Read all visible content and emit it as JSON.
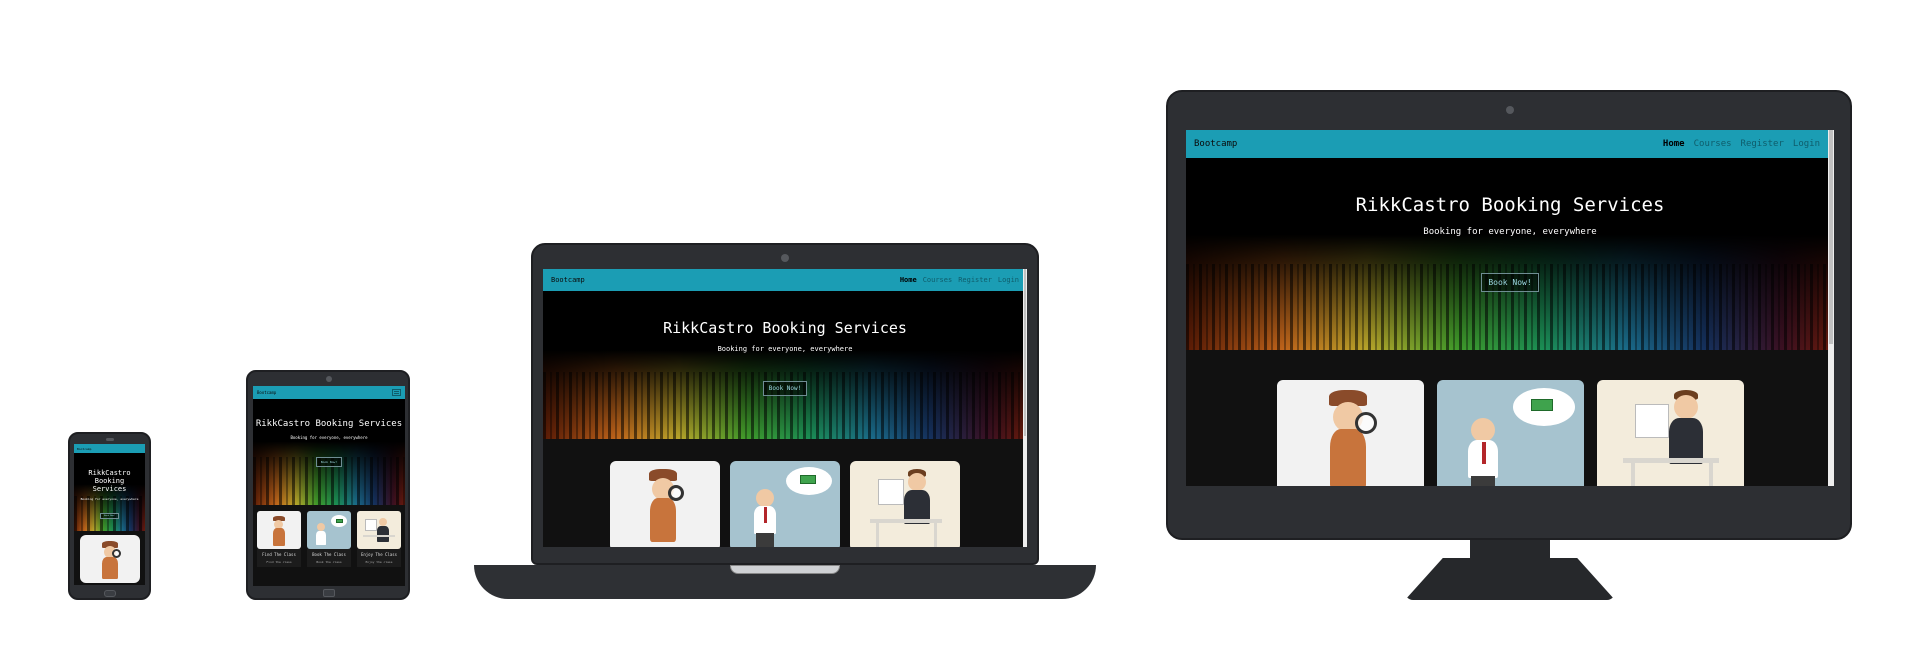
{
  "site": {
    "brand": "Bootcamp",
    "nav": [
      "Home",
      "Courses",
      "Register",
      "Login"
    ],
    "active_nav": "Home",
    "hero_title": "RikkCastro Booking Services",
    "hero_subtitle": "Booking for everyone, everywhere",
    "cta": "Book Now!",
    "cards": [
      {
        "caption": "Find The Class",
        "text": "Find the class"
      },
      {
        "caption": "Book The Class",
        "text": "Book the class"
      },
      {
        "caption": "Enjoy The Class",
        "text": "Enjoy the class"
      }
    ]
  },
  "colors": {
    "navbar": "#1b9db4",
    "device_shell": "#2d2f33",
    "page_bg": "#ffffff",
    "hero_bg": "#000000"
  },
  "icons": [
    "detective-illustration",
    "businessman-thinking-money-illustration",
    "businessman-desk-illustration",
    "hamburger-menu-icon",
    "webcam-icon"
  ]
}
